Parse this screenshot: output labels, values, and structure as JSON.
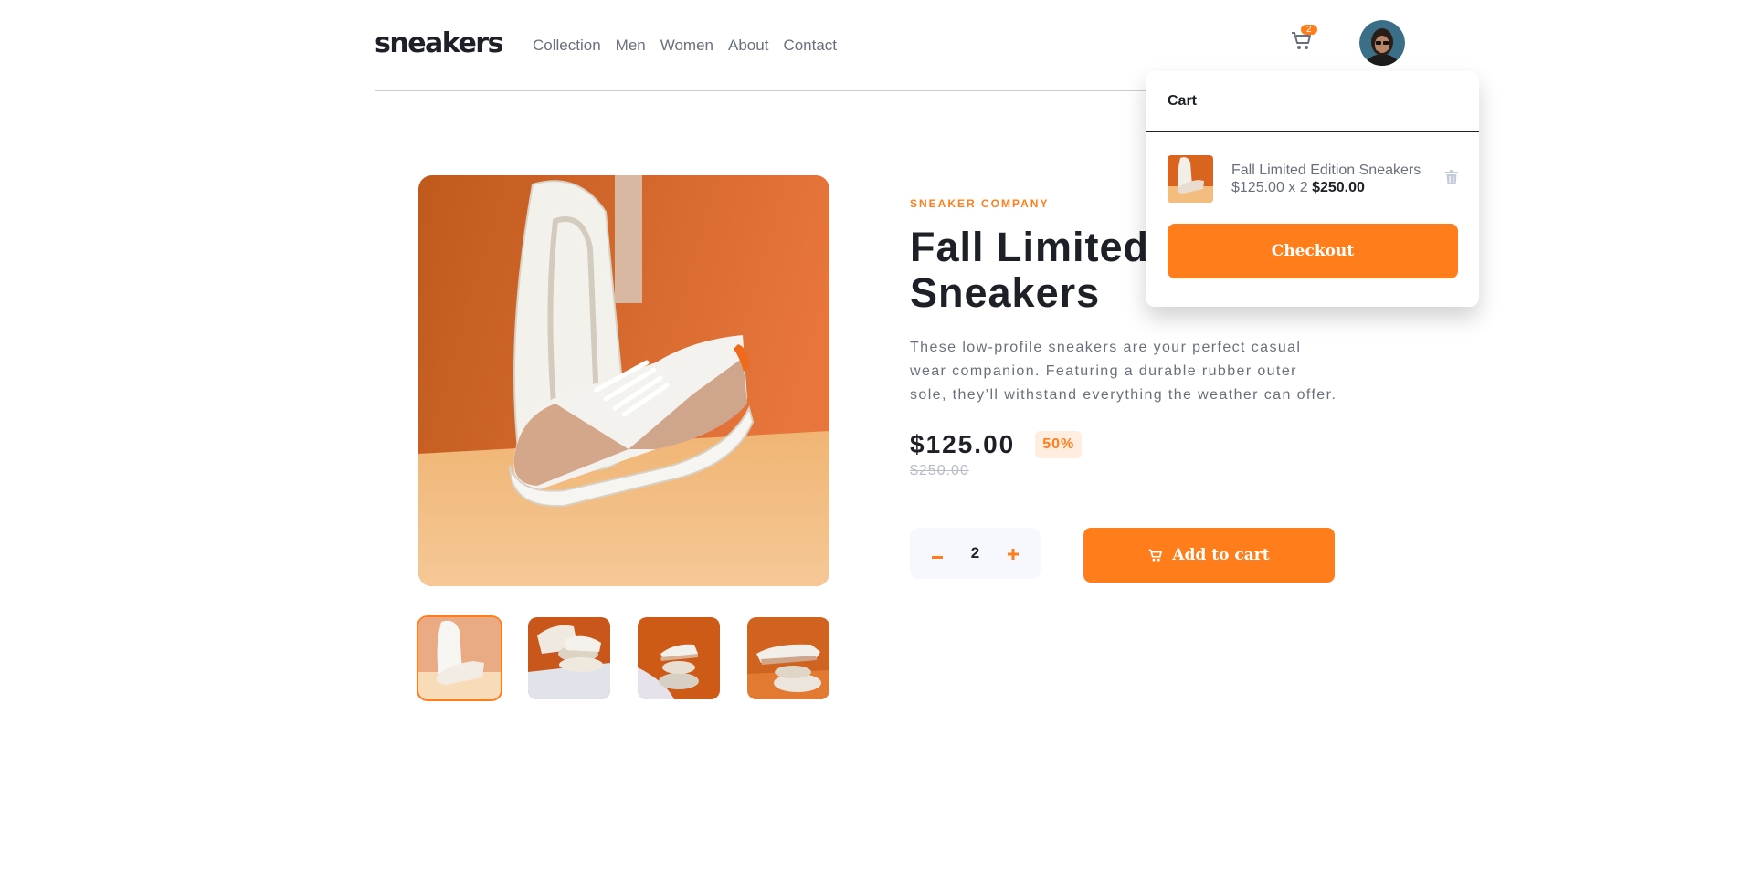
{
  "header": {
    "logo": "sneakers",
    "nav": [
      "Collection",
      "Men",
      "Women",
      "About",
      "Contact"
    ],
    "cart_count": "2"
  },
  "product": {
    "company": "SNEAKER COMPANY",
    "title": "Fall Limited Edition Sneakers",
    "description": "These low-profile sneakers are your perfect casual wear companion. Featuring a durable rubber outer sole, they’ll withstand everything the weather can offer.",
    "price": "$125.00",
    "discount": "50%",
    "old_price": "$250.00",
    "quantity": "2",
    "add_to_cart_label": "Add to cart"
  },
  "cart": {
    "heading": "Cart",
    "item_name": "Fall Limited Edition Sneakers",
    "item_unit": "$125.00 x 2",
    "item_total": "$250.00",
    "checkout_label": "Checkout"
  },
  "colors": {
    "accent": "#ff7e1b",
    "dark": "#1d2026",
    "muted": "#69707d"
  },
  "icons": [
    "cart-icon",
    "avatar",
    "minus-icon",
    "plus-icon",
    "trash-icon"
  ]
}
